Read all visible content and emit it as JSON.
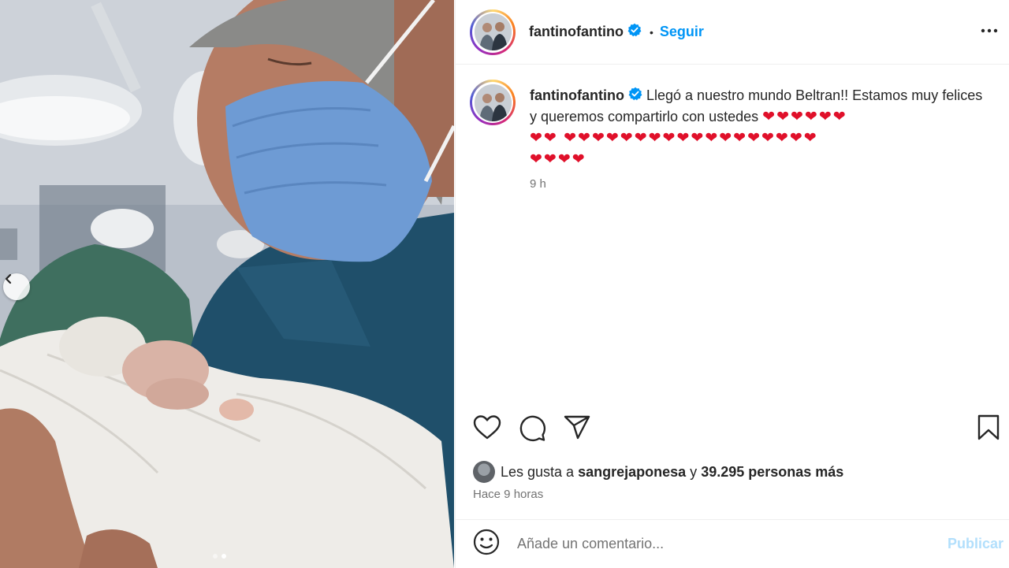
{
  "post": {
    "username": "fantinofantino",
    "verified": true,
    "separator": "•",
    "follow_label": "Seguir",
    "caption_text": "Llegó a nuestro mundo Beltran!! Estamos muy felices y queremos compartirlo con ustedes",
    "caption_hearts_line1": "❤❤❤❤❤❤",
    "caption_hearts_line2": "❤❤ ❤❤❤❤❤❤❤❤❤❤❤❤❤❤❤❤❤❤",
    "caption_hearts_line3": "❤❤❤❤",
    "caption_time": "9 h"
  },
  "likes": {
    "prefix": "Les gusta a",
    "user": "sangrejaponesa",
    "connector": "y",
    "others": "39.295 personas más"
  },
  "posted_ago": "Hace 9 horas",
  "comment": {
    "placeholder": "Añade un comentario...",
    "publish_label": "Publicar"
  },
  "colors": {
    "accent": "#0095f6",
    "publish_disabled": "#b2dffc",
    "heart": "#e0102a",
    "muted": "#737373"
  },
  "icons": [
    "chevron-left-icon",
    "verified-icon",
    "more-icon",
    "heart-icon",
    "comment-icon",
    "share-icon",
    "bookmark-icon",
    "emoji-icon"
  ],
  "carousel": {
    "slides": 2,
    "active": 2
  }
}
